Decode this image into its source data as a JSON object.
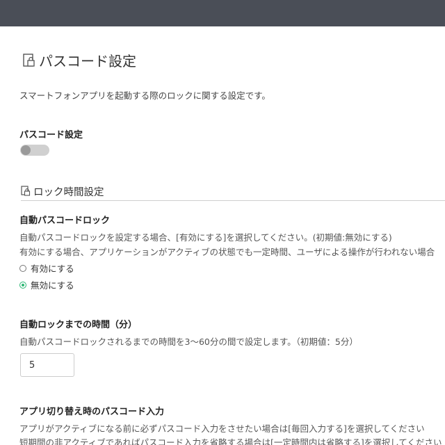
{
  "page": {
    "title": "パスコード設定",
    "description": "スマートフォンアプリを起動する際のロックに関する設定です。"
  },
  "passcode": {
    "label": "パスコード設定",
    "enabled": false
  },
  "lock_section": {
    "title": "ロック時間設定"
  },
  "auto_lock": {
    "label": "自動パスコードロック",
    "desc_line1": "自動パスコードロックを設定する場合、[有効にする]を選択してください。(初期値:無効にする)",
    "desc_line2": "有効にする場合、アプリケーションがアクティブの状態でも一定時間、ユーザによる操作が行われない場合",
    "options": [
      "有効にする",
      "無効にする"
    ],
    "selected": "無効にする"
  },
  "lock_time": {
    "label": "自動ロックまでの時間（分）",
    "desc": "自動パスコードロックされるまでの時間を3〜60分の間で設定します。（初期値：5分）",
    "value": "5"
  },
  "app_switch": {
    "label": "アプリ切り替え時のパスコード入力",
    "desc_line1": "アプリがアクティブになる前に必ずパスコード入力をさせたい場合は[毎回入力する]を選択してください",
    "desc_line2": "短期間の非アクティブであればパスコード入力を省略する場合は[一定時間内は省略する]を選択してください"
  },
  "colors": {
    "topbar": "#4a4e57",
    "accent": "#2bb673"
  }
}
